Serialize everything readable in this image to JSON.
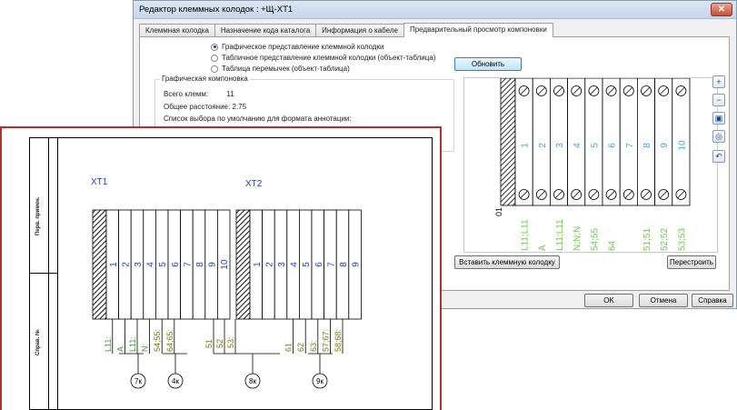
{
  "window": {
    "title": "Редактор клеммных колодок : +Щ-XT1",
    "close_glyph": "✕"
  },
  "tabs": [
    {
      "label": "Клеммная колодка"
    },
    {
      "label": "Назначение кода каталога"
    },
    {
      "label": "Информация о кабеле"
    },
    {
      "label": "Предварительный просмотр компоновки",
      "active": true
    }
  ],
  "options": [
    {
      "label": "Графическое представление клеммной колодки",
      "selected": true
    },
    {
      "label": "Табличное представление клеммной колодки (объект-таблица)",
      "selected": false
    },
    {
      "label": "Таблица перемычек (объект-таблица)",
      "selected": false
    }
  ],
  "layout_group": {
    "title": "Графическая компоновка",
    "total_label": "Всего клемм:",
    "total_value": "11",
    "distance_label": "Общее расстояние:",
    "distance_value": "2.75",
    "annotation_label": "Список выбора по умолчанию для формата аннотации:"
  },
  "buttons": {
    "refresh": "Обновить",
    "insert": "Вставить клеммную колодку",
    "rebuild": "Перестроить",
    "ok": "OK",
    "cancel": "Отмена",
    "help": "Справка"
  },
  "zoom_tools": [
    {
      "icon": "zoom-in-icon",
      "glyph": "+"
    },
    {
      "icon": "zoom-out-icon",
      "glyph": "−"
    },
    {
      "icon": "zoom-window-icon",
      "glyph": "▣"
    },
    {
      "icon": "zoom-extents-icon",
      "glyph": "◎"
    },
    {
      "icon": "zoom-previous-icon",
      "glyph": "↶"
    }
  ],
  "preview": {
    "header_label": "01",
    "terminals": [
      "1",
      "2",
      "3",
      "4",
      "5",
      "6",
      "7",
      "8",
      "9",
      "10"
    ],
    "wire_labels": [
      "L11;L11",
      "A",
      "L11;L11",
      "N;N;N",
      "54;55",
      "64",
      "",
      "51;51",
      "52;52",
      "53;53"
    ]
  },
  "drawing": {
    "stamp_labels": [
      "Перв. примен.",
      "Справ. №"
    ],
    "blocks": [
      {
        "tag": "XT1",
        "terminals": [
          "1",
          "2",
          "3",
          "4",
          "5",
          "6",
          "7",
          "8",
          "9",
          "10"
        ],
        "wires": [
          "L11:",
          "A",
          "L11:",
          "N:",
          "54;55:",
          "64;65:",
          "",
          "",
          "",
          ""
        ]
      },
      {
        "tag": "XT2",
        "terminals": [
          "1",
          "2",
          "3",
          "4",
          "5",
          "6",
          "7",
          "8",
          "9"
        ],
        "wires": [
          "",
          "",
          "",
          "61",
          "62",
          "63:",
          "57;67:",
          "58;68:",
          ""
        ]
      }
    ],
    "jumpers_between": [
      "51",
      "52",
      "53:"
    ],
    "cable_markers": [
      "7к",
      "4к",
      "8к",
      "9к"
    ]
  },
  "colors": {
    "terminal_text": "#38a8d8",
    "wire_text": "#6cc44a",
    "sheet_border": "#b03030",
    "title_blue": "#1f3fbf"
  }
}
